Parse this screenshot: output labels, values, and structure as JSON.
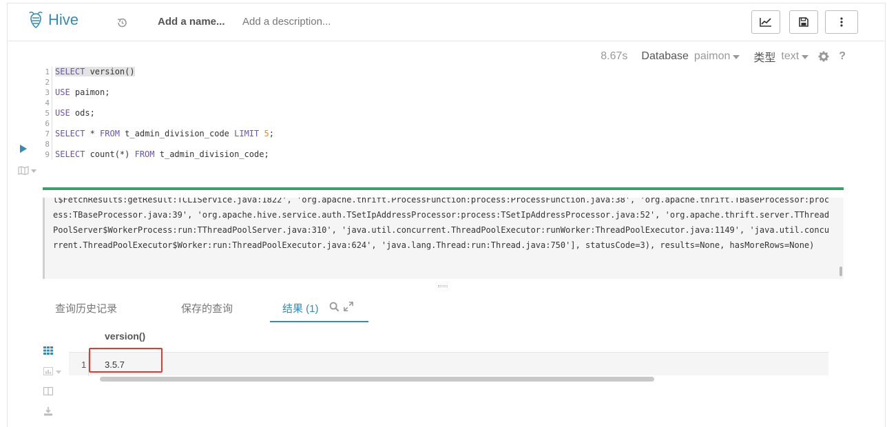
{
  "header": {
    "app_name": "Hive",
    "query_name_placeholder": "Add a name...",
    "query_description_placeholder": "Add a description..."
  },
  "toolbar": {
    "exec_time": "8.67s",
    "database_label": "Database",
    "database_value": "paimon",
    "type_label": "类型",
    "type_value": "text",
    "help_label": "?"
  },
  "editor": {
    "line_numbers": [
      "1",
      "2",
      "3",
      "4",
      "5",
      "6",
      "7",
      "8",
      "9"
    ],
    "lines": [
      "SELECT version()",
      "",
      "USE paimon;",
      "",
      "USE ods;",
      "",
      "SELECT * FROM t_admin_division_code LIMIT 5;",
      "",
      "SELECT count(*) FROM t_admin_division_code;"
    ]
  },
  "log": {
    "text": "l$FetchResults:getResult:TCLIService.java:1822', 'org.apache.thrift.ProcessFunction:process:ProcessFunction.java:38', 'org.apache.thrift.TBaseProcessor:process:TBaseProcessor.java:39', 'org.apache.hive.service.auth.TSetIpAddressProcessor:process:TSetIpAddressProcessor.java:52', 'org.apache.thrift.server.TThreadPoolServer$WorkerProcess:run:TThreadPoolServer.java:310', 'java.util.concurrent.ThreadPoolExecutor:runWorker:ThreadPoolExecutor.java:1149', 'java.util.concurrent.ThreadPoolExecutor$Worker:run:ThreadPoolExecutor.java:624', 'java.lang.Thread:run:Thread.java:750'], statusCode=3), results=None, hasMoreRows=None)"
  },
  "tabs": {
    "history": "查询历史记录",
    "saved": "保存的查询",
    "results": "结果 (1)"
  },
  "results": {
    "columns": [
      "version()"
    ],
    "rows": [
      {
        "num": "1",
        "cells": [
          "3.5.7"
        ]
      }
    ]
  },
  "colors": {
    "accent": "#338bb8",
    "progress": "#3ca06b",
    "highlight_box": "#e23b2e"
  }
}
